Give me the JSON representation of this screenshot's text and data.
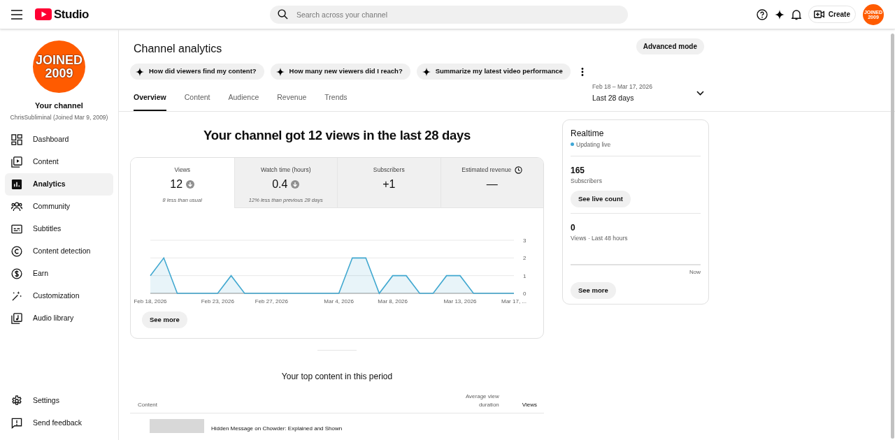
{
  "header": {
    "logo_text": "Studio",
    "search": {
      "placeholder": "Search across your channel"
    },
    "create_label": "Create",
    "avatar_text": "JOINED 2009"
  },
  "sidebar": {
    "avatar_text": "JOINED 2009",
    "channel_title": "Your channel",
    "channel_subtitle": "ChrisSubliminal (Joined Mar 9, 2009)",
    "items": [
      {
        "label": "Dashboard",
        "selected": false
      },
      {
        "label": "Content",
        "selected": false
      },
      {
        "label": "Analytics",
        "selected": true
      },
      {
        "label": "Community",
        "selected": false
      },
      {
        "label": "Subtitles",
        "selected": false
      },
      {
        "label": "Content detection",
        "selected": false
      },
      {
        "label": "Earn",
        "selected": false
      },
      {
        "label": "Customization",
        "selected": false
      },
      {
        "label": "Audio library",
        "selected": false
      }
    ],
    "footer_items": [
      {
        "label": "Settings"
      },
      {
        "label": "Send feedback"
      }
    ]
  },
  "page": {
    "title": "Channel analytics",
    "advanced_button": "Advanced mode",
    "prompts": [
      "How did viewers find my content?",
      "How many new viewers did I reach?",
      "Summarize my latest video performance"
    ],
    "tabs": [
      {
        "label": "Overview",
        "selected": true
      },
      {
        "label": "Content",
        "selected": false
      },
      {
        "label": "Audience",
        "selected": false
      },
      {
        "label": "Revenue",
        "selected": false
      },
      {
        "label": "Trends",
        "selected": false
      }
    ],
    "date_range": {
      "range": "Feb 18 – Mar 17, 2026",
      "label": "Last 28 days"
    }
  },
  "summary": {
    "headline": "Your channel got 12 views in the last 28 days",
    "metrics": [
      {
        "label": "Views",
        "value": "12",
        "trend_down": true,
        "info_icon": false,
        "note": "8 less than usual",
        "selected": true
      },
      {
        "label": "Watch time (hours)",
        "value": "0.4",
        "trend_down": true,
        "info_icon": false,
        "note": "12% less than previous 28 days",
        "selected": false
      },
      {
        "label": "Subscribers",
        "value": "+1",
        "trend_down": false,
        "info_icon": false,
        "selected": false
      },
      {
        "label": "Estimated revenue",
        "value": "—",
        "trend_down": false,
        "info_icon": true,
        "selected": false
      }
    ],
    "chart_data": {
      "type": "area",
      "categories": [
        "Feb 18, 2026",
        null,
        null,
        null,
        null,
        "Feb 23, 2026",
        null,
        null,
        null,
        "Feb 27, 2026",
        null,
        null,
        null,
        null,
        "Mar 4, 2026",
        null,
        null,
        null,
        "Mar 8, 2026",
        null,
        null,
        null,
        null,
        "Mar 13, 2026",
        null,
        null,
        null,
        "Mar 17, ..."
      ],
      "series": [
        {
          "color": "#41a8d0",
          "values": [
            1,
            2,
            0,
            0,
            0,
            0,
            1,
            0,
            0,
            0,
            0,
            0,
            0,
            0,
            0,
            2,
            2,
            0,
            1,
            1,
            0,
            0,
            1,
            1,
            0,
            0,
            0,
            0
          ]
        }
      ],
      "ylim": [
        0,
        3
      ],
      "yticks": [
        0,
        1,
        2,
        3
      ]
    },
    "see_more": "See more"
  },
  "realtime": {
    "title": "Realtime",
    "status": "Updating live",
    "subscribers_value": "165",
    "subscribers_label": "Subscribers",
    "live_button": "See live count",
    "views_value": "0",
    "views_label": "Views · Last 48 hours",
    "axis_label": "Now",
    "see_more": "See more"
  },
  "top_content": {
    "title": "Your top content in this period",
    "columns": [
      "Content",
      "Average view duration",
      "Views"
    ],
    "rows": [
      {
        "title": "Hidden Message on Chowder: Explained and Shown"
      }
    ]
  }
}
